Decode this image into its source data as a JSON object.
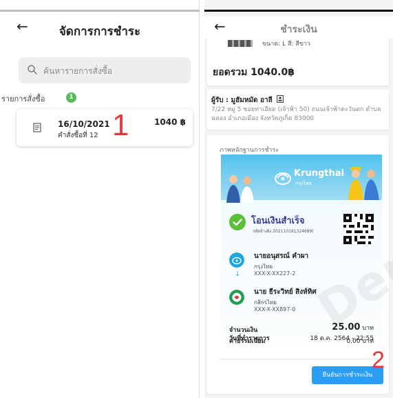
{
  "left": {
    "title": "จัดการการชำระ",
    "search_placeholder": "ค้นหารายการสั่งซื้อ",
    "orders_label": "รายการสั่งซื้อ",
    "orders_count": "1",
    "order": {
      "date": "16/10/2021",
      "number": "คำสั่งซื้อที่ 12",
      "amount": "1040 ฿"
    },
    "annotation": "1"
  },
  "right": {
    "title": "ชำระเงิน",
    "product_spec": "ขนาด: L สี: สีขาว",
    "total": "ยอดรวม 1040.0฿",
    "recipient": "ผู้รับ : มูฮัมหมัด อาลี",
    "address": "7/22 หมู่ 5 ซอยท่าเอียด (เจ้าฟ้า 50) ถนนเจ้าฟ้าตะวันตก ตำบลฉลอง อำเภอเมือง จังหวัดภูเก็ต 83000",
    "proof_label": "ภาพหลักฐานการชำระ",
    "slip": {
      "bank_name": "Krungthai",
      "bank_thai": "กรุงไทย",
      "success_title": "โอนเงินสำเร็จ",
      "ref": "รหัสอ้างอิง 202110181324699l",
      "from_name": "นายอนุสรณ์ คำผา",
      "from_bank": "กรุงไทย",
      "from_account": "XXX-X-XX227-2",
      "to_name": "นาย ธีระวิทย์ สิงห์ทิศ",
      "to_bank": "กสิกรไทย",
      "to_account": "XXX-X-XX897-0",
      "amount_label": "จำนวนเงิน",
      "amount_value": "25.00",
      "fee_label": "ค่าธรรมเนียม",
      "fee_value": "0.00",
      "currency": "บาท",
      "date_label": "วันที่ทำรายการ",
      "date_value": "18 ต.ค. 2564 - 22:55"
    },
    "confirm_button": "ยืนยันการชำระเงิน",
    "annotation": "2"
  },
  "colors": {
    "accent_blue": "#2a9df4",
    "success_green": "#5bbf3a",
    "badge_green": "#5cb85c",
    "annotation_red": "#e33a3a",
    "krungthai_blue": "#52c1ec"
  }
}
